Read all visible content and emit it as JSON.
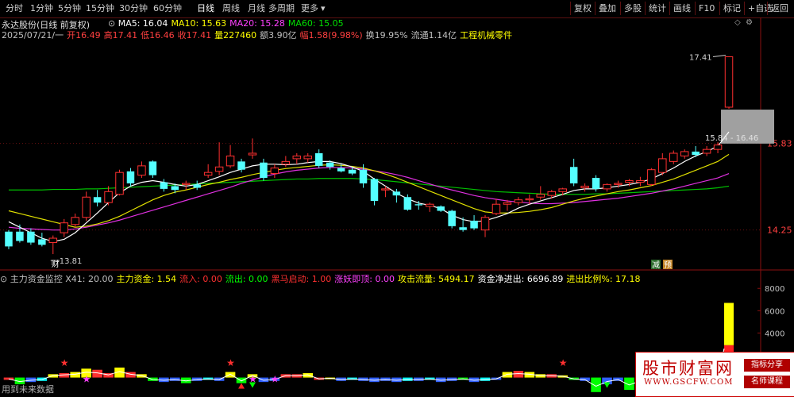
{
  "toolbar": {
    "periods": [
      "分时",
      "1分钟",
      "5分钟",
      "15分钟",
      "30分钟",
      "60分钟",
      "日线",
      "周线",
      "月线",
      "多周期",
      "更多"
    ],
    "active_period": "日线",
    "more_arrow": "▾",
    "right_buttons": [
      "复权",
      "叠加",
      "多股",
      "统计",
      "画线",
      "F10",
      "标记",
      "+自选",
      "返回"
    ]
  },
  "header": {
    "stock_title": "永达股份(日线 前复权)",
    "ma_icon": "circle-chevron-icon",
    "ma": [
      {
        "label": "MA5: 16.04",
        "color": "#ffffff"
      },
      {
        "label": "MA10: 15.63",
        "color": "#ffff00"
      },
      {
        "label": "MA20: 15.28",
        "color": "#ff40ff"
      },
      {
        "label": "MA60: 15.05",
        "color": "#00e000"
      }
    ],
    "quote": [
      {
        "text": "2025/07/21/一",
        "color": "#c0c0c0"
      },
      {
        "text": "开16.49",
        "color": "#ff4040"
      },
      {
        "text": "高17.41",
        "color": "#ff4040"
      },
      {
        "text": "低16.46",
        "color": "#ff4040"
      },
      {
        "text": "收17.41",
        "color": "#ff4040"
      },
      {
        "text": "量227460",
        "color": "#ffff00"
      },
      {
        "text": "额3.90亿",
        "color": "#c0c0c0"
      },
      {
        "text": "幅1.58(9.98%)",
        "color": "#ff4040"
      },
      {
        "text": "换19.95%",
        "color": "#c0c0c0"
      },
      {
        "text": "流通1.14亿",
        "color": "#c0c0c0"
      },
      {
        "text": "工程机械零件",
        "color": "#ffff00"
      }
    ],
    "icons": [
      "diamond-icon",
      "settings-icon"
    ]
  },
  "indicator": {
    "items": [
      {
        "text": "主力资金监控  X41: 20.00",
        "color": "#c0c0c0"
      },
      {
        "text": "主力资金: 1.54",
        "color": "#ffff00"
      },
      {
        "text": "流入: 0.00",
        "color": "#ff3030"
      },
      {
        "text": "流出: 0.00",
        "color": "#00ff00"
      },
      {
        "text": "黑马启动: 1.00",
        "color": "#ff3030"
      },
      {
        "text": "涨妖即顶: 0.00",
        "color": "#ff40ff"
      },
      {
        "text": "攻击流量: 5494.17",
        "color": "#ffff00"
      },
      {
        "text": "资金净进出: 6696.89",
        "color": "#ffffff"
      },
      {
        "text": "进出比例%: 17.18",
        "color": "#ffff00"
      }
    ]
  },
  "footer": {
    "text": "用到未来数据"
  },
  "watermark": {
    "main": "股市财富网",
    "url": "WWW.GSCFW.COM",
    "badge1": "指标分享",
    "badge2": "名师课程"
  },
  "chart_data": [
    {
      "type": "candlestick",
      "y_ticks": [
        14.25,
        15.83
      ],
      "ylim": [
        13.55,
        17.75
      ],
      "up_color": "#ff3030",
      "down_color": "#54ffff",
      "candles": [
        {
          "o": 14.22,
          "h": 14.25,
          "l": 13.9,
          "c": 13.95
        },
        {
          "o": 14.22,
          "h": 14.35,
          "l": 14.02,
          "c": 14.05
        },
        {
          "o": 14.22,
          "h": 14.28,
          "l": 13.98,
          "c": 14.02
        },
        {
          "o": 14.08,
          "h": 14.2,
          "l": 13.95,
          "c": 13.98
        },
        {
          "o": 14.02,
          "h": 14.15,
          "l": 13.81,
          "c": 14.1
        },
        {
          "o": 14.2,
          "h": 14.45,
          "l": 14.12,
          "c": 14.38
        },
        {
          "o": 14.35,
          "h": 14.55,
          "l": 14.3,
          "c": 14.48
        },
        {
          "o": 14.48,
          "h": 14.95,
          "l": 14.42,
          "c": 14.85
        },
        {
          "o": 14.85,
          "h": 14.98,
          "l": 14.68,
          "c": 14.75
        },
        {
          "o": 14.75,
          "h": 15.05,
          "l": 14.7,
          "c": 14.95
        },
        {
          "o": 14.9,
          "h": 15.35,
          "l": 14.88,
          "c": 15.3
        },
        {
          "o": 15.32,
          "h": 15.38,
          "l": 15.05,
          "c": 15.1
        },
        {
          "o": 15.25,
          "h": 15.5,
          "l": 15.2,
          "c": 15.42
        },
        {
          "o": 15.5,
          "h": 15.52,
          "l": 15.2,
          "c": 15.25
        },
        {
          "o": 15.12,
          "h": 15.18,
          "l": 14.95,
          "c": 15.0
        },
        {
          "o": 15.05,
          "h": 15.1,
          "l": 14.92,
          "c": 14.98
        },
        {
          "o": 15.08,
          "h": 15.15,
          "l": 14.98,
          "c": 15.1
        },
        {
          "o": 15.08,
          "h": 15.15,
          "l": 14.98,
          "c": 15.02
        },
        {
          "o": 15.25,
          "h": 15.45,
          "l": 15.2,
          "c": 15.3
        },
        {
          "o": 15.32,
          "h": 15.85,
          "l": 15.25,
          "c": 15.4
        },
        {
          "o": 15.42,
          "h": 15.8,
          "l": 15.38,
          "c": 15.6
        },
        {
          "o": 15.5,
          "h": 15.55,
          "l": 15.3,
          "c": 15.35
        },
        {
          "o": 15.62,
          "h": 15.92,
          "l": 15.55,
          "c": 15.65
        },
        {
          "o": 15.48,
          "h": 15.55,
          "l": 15.15,
          "c": 15.2
        },
        {
          "o": 15.28,
          "h": 15.45,
          "l": 15.2,
          "c": 15.38
        },
        {
          "o": 15.45,
          "h": 15.6,
          "l": 15.4,
          "c": 15.5
        },
        {
          "o": 15.55,
          "h": 15.65,
          "l": 15.45,
          "c": 15.6
        },
        {
          "o": 15.55,
          "h": 15.65,
          "l": 15.48,
          "c": 15.6
        },
        {
          "o": 15.65,
          "h": 15.72,
          "l": 15.38,
          "c": 15.42
        },
        {
          "o": 15.48,
          "h": 15.52,
          "l": 15.35,
          "c": 15.4
        },
        {
          "o": 15.38,
          "h": 15.45,
          "l": 15.3,
          "c": 15.32
        },
        {
          "o": 15.35,
          "h": 15.4,
          "l": 15.25,
          "c": 15.28
        },
        {
          "o": 15.35,
          "h": 15.45,
          "l": 15.02,
          "c": 15.1
        },
        {
          "o": 15.18,
          "h": 15.2,
          "l": 14.7,
          "c": 14.78
        },
        {
          "o": 14.98,
          "h": 15.05,
          "l": 14.85,
          "c": 15.0
        },
        {
          "o": 14.95,
          "h": 15.0,
          "l": 14.75,
          "c": 14.88
        },
        {
          "o": 14.85,
          "h": 14.9,
          "l": 14.6,
          "c": 14.62
        },
        {
          "o": 14.72,
          "h": 14.78,
          "l": 14.62,
          "c": 14.7
        },
        {
          "o": 14.68,
          "h": 14.75,
          "l": 14.58,
          "c": 14.72
        },
        {
          "o": 14.68,
          "h": 14.7,
          "l": 14.58,
          "c": 14.6
        },
        {
          "o": 14.6,
          "h": 14.62,
          "l": 14.28,
          "c": 14.32
        },
        {
          "o": 14.3,
          "h": 14.48,
          "l": 14.22,
          "c": 14.25
        },
        {
          "o": 14.42,
          "h": 14.52,
          "l": 14.25,
          "c": 14.28
        },
        {
          "o": 14.25,
          "h": 14.52,
          "l": 14.12,
          "c": 14.48
        },
        {
          "o": 14.55,
          "h": 14.82,
          "l": 14.52,
          "c": 14.72
        },
        {
          "o": 14.72,
          "h": 14.8,
          "l": 14.6,
          "c": 14.75
        },
        {
          "o": 14.75,
          "h": 14.85,
          "l": 14.7,
          "c": 14.8
        },
        {
          "o": 14.8,
          "h": 14.9,
          "l": 14.72,
          "c": 14.82
        },
        {
          "o": 14.85,
          "h": 15.05,
          "l": 14.8,
          "c": 14.9
        },
        {
          "o": 14.88,
          "h": 14.98,
          "l": 14.82,
          "c": 14.95
        },
        {
          "o": 14.95,
          "h": 15.02,
          "l": 14.88,
          "c": 15.0
        },
        {
          "o": 15.4,
          "h": 15.55,
          "l": 15.05,
          "c": 15.1
        },
        {
          "o": 15.02,
          "h": 15.1,
          "l": 14.95,
          "c": 15.05
        },
        {
          "o": 15.2,
          "h": 15.25,
          "l": 14.95,
          "c": 15.0
        },
        {
          "o": 15.0,
          "h": 15.1,
          "l": 14.95,
          "c": 15.08
        },
        {
          "o": 15.08,
          "h": 15.15,
          "l": 15.02,
          "c": 15.1
        },
        {
          "o": 15.12,
          "h": 15.18,
          "l": 15.05,
          "c": 15.15
        },
        {
          "o": 15.12,
          "h": 15.22,
          "l": 15.05,
          "c": 15.15
        },
        {
          "o": 15.08,
          "h": 15.38,
          "l": 15.05,
          "c": 15.35
        },
        {
          "o": 15.3,
          "h": 15.65,
          "l": 15.25,
          "c": 15.55
        },
        {
          "o": 15.5,
          "h": 15.7,
          "l": 15.45,
          "c": 15.65
        },
        {
          "o": 15.6,
          "h": 15.72,
          "l": 15.55,
          "c": 15.68
        },
        {
          "o": 15.68,
          "h": 15.78,
          "l": 15.58,
          "c": 15.62
        },
        {
          "o": 15.65,
          "h": 15.78,
          "l": 15.6,
          "c": 15.72
        },
        {
          "o": 15.72,
          "h": 15.85,
          "l": 15.65,
          "c": 15.8
        },
        {
          "o": 16.49,
          "h": 17.41,
          "l": 16.46,
          "c": 17.41
        }
      ],
      "ma5": [
        14.4,
        14.3,
        14.2,
        14.1,
        14.04,
        14.08,
        14.2,
        14.38,
        14.56,
        14.75,
        14.93,
        15.05,
        15.12,
        15.15,
        15.12,
        15.08,
        15.05,
        15.08,
        15.15,
        15.22,
        15.3,
        15.36,
        15.42,
        15.45,
        15.45,
        15.44,
        15.45,
        15.48,
        15.5,
        15.5,
        15.46,
        15.4,
        15.32,
        15.18,
        15.05,
        14.92,
        14.82,
        14.74,
        14.7,
        14.64,
        14.52,
        14.44,
        14.4,
        14.42,
        14.48,
        14.55,
        14.65,
        14.72,
        14.78,
        14.84,
        14.9,
        14.97,
        15.0,
        15.0,
        15.02,
        15.05,
        15.08,
        15.12,
        15.18,
        15.28,
        15.38,
        15.5,
        15.6,
        15.68,
        15.78,
        16.04
      ],
      "ma10": [
        14.6,
        14.55,
        14.5,
        14.45,
        14.4,
        14.35,
        14.3,
        14.32,
        14.36,
        14.42,
        14.5,
        14.6,
        14.7,
        14.8,
        14.88,
        14.94,
        14.98,
        15.03,
        15.08,
        15.12,
        15.17,
        15.21,
        15.26,
        15.3,
        15.34,
        15.37,
        15.39,
        15.41,
        15.43,
        15.44,
        15.43,
        15.41,
        15.38,
        15.33,
        15.27,
        15.2,
        15.12,
        15.04,
        14.96,
        14.88,
        14.8,
        14.72,
        14.64,
        14.58,
        14.56,
        14.56,
        14.57,
        14.59,
        14.62,
        14.66,
        14.72,
        14.78,
        14.83,
        14.87,
        14.91,
        14.95,
        14.98,
        15.02,
        15.06,
        15.12,
        15.18,
        15.26,
        15.34,
        15.42,
        15.5,
        15.63
      ],
      "ma20": [
        14.3,
        14.28,
        14.27,
        14.26,
        14.25,
        14.25,
        14.27,
        14.3,
        14.34,
        14.38,
        14.43,
        14.49,
        14.55,
        14.61,
        14.67,
        14.73,
        14.79,
        14.85,
        14.91,
        14.97,
        15.03,
        15.1,
        15.16,
        15.22,
        15.27,
        15.31,
        15.34,
        15.36,
        15.38,
        15.39,
        15.39,
        15.38,
        15.36,
        15.33,
        15.3,
        15.26,
        15.21,
        15.15,
        15.09,
        15.03,
        14.98,
        14.93,
        14.88,
        14.84,
        14.81,
        14.78,
        14.76,
        14.74,
        14.73,
        14.73,
        14.74,
        14.75,
        14.77,
        14.79,
        14.81,
        14.83,
        14.86,
        14.89,
        14.92,
        14.96,
        15.0,
        15.05,
        15.1,
        15.15,
        15.2,
        15.28
      ],
      "ma60": [
        14.98,
        14.98,
        14.98,
        14.98,
        14.99,
        14.99,
        14.99,
        15.0,
        15.0,
        15.01,
        15.02,
        15.03,
        15.04,
        15.05,
        15.06,
        15.07,
        15.08,
        15.09,
        15.1,
        15.11,
        15.12,
        15.13,
        15.14,
        15.15,
        15.16,
        15.17,
        15.18,
        15.18,
        15.19,
        15.19,
        15.19,
        15.19,
        15.18,
        15.17,
        15.15,
        15.13,
        15.11,
        15.09,
        15.07,
        15.05,
        15.03,
        15.01,
        14.99,
        14.97,
        14.95,
        14.94,
        14.93,
        14.92,
        14.91,
        14.9,
        14.9,
        14.9,
        14.9,
        14.91,
        14.91,
        14.92,
        14.93,
        14.94,
        14.95,
        14.96,
        14.97,
        14.98,
        14.99,
        15.0,
        15.02,
        15.05
      ],
      "annotations": [
        {
          "text": "17.41",
          "kind": "high"
        },
        {
          "text": "13.81",
          "kind": "low"
        },
        {
          "text": "15.84 - 16.46",
          "kind": "gap"
        },
        {
          "text": "财",
          "kind": "marker"
        },
        {
          "text": "减",
          "kind": "marker"
        },
        {
          "text": "预",
          "kind": "marker"
        }
      ]
    },
    {
      "type": "bar",
      "title": "主力资金监控",
      "y_ticks": [
        2000,
        4000,
        6000,
        8000
      ],
      "ylim": [
        -1600,
        8800
      ],
      "bars": [
        {
          "v": -200,
          "c": "#ff3030"
        },
        {
          "v": -600,
          "c": "#00ff00"
        },
        {
          "v": -400,
          "c": "#3060ff"
        },
        {
          "v": -300,
          "c": "#00ffff"
        },
        {
          "v": 300,
          "c": "#ffff00"
        },
        {
          "v": 400,
          "c": "#ff3030"
        },
        {
          "v": 500,
          "c": "#ffff00"
        },
        {
          "v": 800,
          "c": "#ffff00"
        },
        {
          "v": 700,
          "c": "#ff3030"
        },
        {
          "v": 400,
          "c": "#ff3030"
        },
        {
          "v": 900,
          "c": "#ffff00"
        },
        {
          "v": 500,
          "c": "#ff3030"
        },
        {
          "v": 300,
          "c": "#ffff00"
        },
        {
          "v": -300,
          "c": "#00ff00"
        },
        {
          "v": -400,
          "c": "#3060ff"
        },
        {
          "v": -300,
          "c": "#3060ff"
        },
        {
          "v": -500,
          "c": "#00ff00"
        },
        {
          "v": -300,
          "c": "#3060ff"
        },
        {
          "v": -200,
          "c": "#00ffff"
        },
        {
          "v": -300,
          "c": "#3060ff"
        },
        {
          "v": 500,
          "c": "#ffff00"
        },
        {
          "v": -500,
          "c": "#00ff00"
        },
        {
          "v": 300,
          "c": "#ffff00"
        },
        {
          "v": -400,
          "c": "#3060ff"
        },
        {
          "v": -300,
          "c": "#3060ff"
        },
        {
          "v": 300,
          "c": "#ff3030"
        },
        {
          "v": 300,
          "c": "#ff3030"
        },
        {
          "v": 400,
          "c": "#ffff00"
        },
        {
          "v": -200,
          "c": "#ff3030"
        },
        {
          "v": -100,
          "c": "#ffff00"
        },
        {
          "v": -300,
          "c": "#3060ff"
        },
        {
          "v": -200,
          "c": "#00ffff"
        },
        {
          "v": -300,
          "c": "#3060ff"
        },
        {
          "v": -400,
          "c": "#3060ff"
        },
        {
          "v": -300,
          "c": "#3060ff"
        },
        {
          "v": -400,
          "c": "#3060ff"
        },
        {
          "v": -300,
          "c": "#00ffff"
        },
        {
          "v": -300,
          "c": "#3060ff"
        },
        {
          "v": -200,
          "c": "#00ffff"
        },
        {
          "v": -400,
          "c": "#3060ff"
        },
        {
          "v": -300,
          "c": "#3060ff"
        },
        {
          "v": -200,
          "c": "#00ff00"
        },
        {
          "v": -400,
          "c": "#3060ff"
        },
        {
          "v": -300,
          "c": "#00ffff"
        },
        {
          "v": -200,
          "c": "#3060ff"
        },
        {
          "v": 500,
          "c": "#ffff00"
        },
        {
          "v": 600,
          "c": "#ff3030"
        },
        {
          "v": 500,
          "c": "#ffff00"
        },
        {
          "v": 300,
          "c": "#ffff00"
        },
        {
          "v": 300,
          "c": "#ff3030"
        },
        {
          "v": 200,
          "c": "#ffff00"
        },
        {
          "v": -200,
          "c": "#00ff00"
        },
        {
          "v": -300,
          "c": "#3060ff"
        },
        {
          "v": -1300,
          "c": "#00ff00"
        },
        {
          "v": -600,
          "c": "#3060ff"
        },
        {
          "v": -300,
          "c": "#3060ff"
        },
        {
          "v": -1100,
          "c": "#00ff00"
        },
        {
          "v": -500,
          "c": "#3060ff"
        },
        {
          "v": -300,
          "c": "#00ffff"
        },
        {
          "v": -700,
          "c": "#00ff00"
        },
        {
          "v": -400,
          "c": "#3060ff"
        },
        {
          "v": -300,
          "c": "#3060ff"
        },
        {
          "v": 200,
          "c": "#ffff00"
        },
        {
          "v": -200,
          "c": "#3060ff"
        },
        {
          "v": -300,
          "c": "#3060ff"
        },
        {
          "v": 6700,
          "c": "#ffff00"
        }
      ],
      "stars": [
        5,
        20,
        50,
        57
      ],
      "pink_stars": [
        7,
        22,
        24,
        58
      ],
      "triangles_up": [
        21
      ],
      "triangles_down": [
        22,
        54
      ]
    }
  ]
}
